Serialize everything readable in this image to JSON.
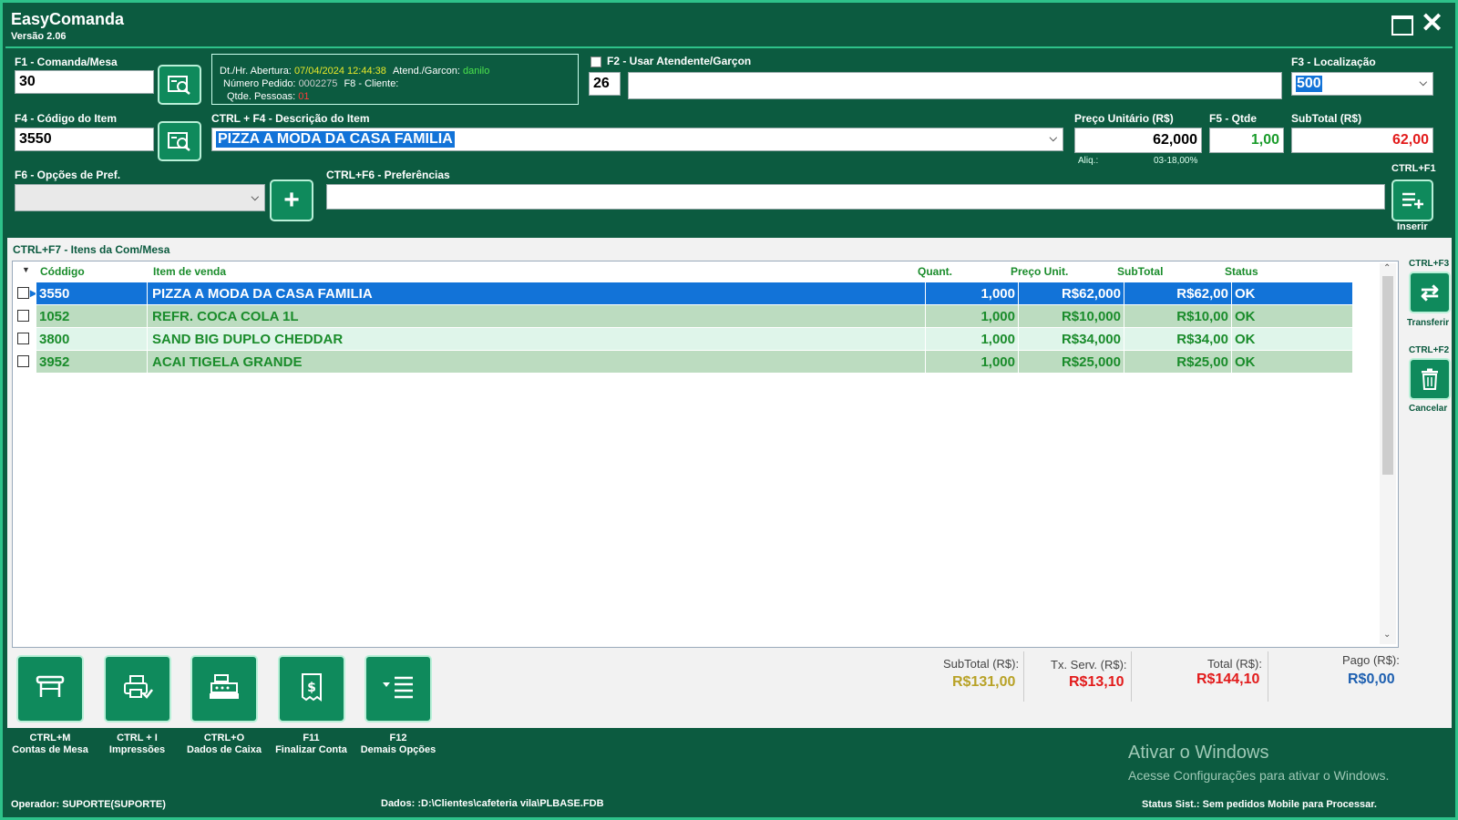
{
  "window": {
    "title": "EasyComanda",
    "version": "Versão 2.06"
  },
  "comanda": {
    "label": "F1 - Comanda/Mesa",
    "value": "30"
  },
  "info": {
    "abertura_label": "Dt./Hr. Abertura:",
    "abertura_value": "07/04/2024 12:44:38",
    "atend_label": "Atend./Garcon:",
    "atend_value": "danilo",
    "pedido_label": "Número Pedido:",
    "pedido_value": "0002275",
    "cliente_label": "F8 - Cliente:",
    "pessoas_label": "Qtde. Pessoas:",
    "pessoas_value": "01"
  },
  "atendente": {
    "label": "F2 - Usar Atendente/Garçon",
    "code": "26",
    "name": ""
  },
  "localizacao": {
    "label": "F3 - Localização",
    "value": "500"
  },
  "item": {
    "codigo_label": "F4 - Código do Item",
    "codigo_value": "3550",
    "descricao_label": "CTRL + F4 - Descrição do Item",
    "descricao_value": "PIZZA A MODA DA CASA FAMILIA",
    "preco_label": "Preço Unitário (R$)",
    "preco_value": "62,000",
    "aliq_label": "Aliq.:",
    "aliq_value": "03-18,00%",
    "qtde_label": "F5 - Qtde",
    "qtde_value": "1,00",
    "subtotal_label": "SubTotal (R$)",
    "subtotal_value": "62,00"
  },
  "pref": {
    "opcoes_label": "F6 - Opções de Pref.",
    "preferencias_label": "CTRL+F6 - Preferências",
    "inserir_shortcut": "CTRL+F1",
    "inserir_label": "Inserir"
  },
  "grid": {
    "title": "CTRL+F7 - Itens da Com/Mesa",
    "headers": {
      "codigo": "Códdigo",
      "item": "Item de venda",
      "quant": "Quant.",
      "preco": "Preço Unit.",
      "subtotal": "SubTotal",
      "status": "Status"
    },
    "rows": [
      {
        "codigo": "3550",
        "item": "PIZZA A MODA DA CASA FAMILIA",
        "quant": "1,000",
        "preco": "R$62,000",
        "subtotal": "R$62,00",
        "status": "OK"
      },
      {
        "codigo": "1052",
        "item": "REFR. COCA COLA 1L",
        "quant": "1,000",
        "preco": "R$10,000",
        "subtotal": "R$10,00",
        "status": "OK"
      },
      {
        "codigo": "3800",
        "item": "SAND BIG DUPLO CHEDDAR",
        "quant": "1,000",
        "preco": "R$34,000",
        "subtotal": "R$34,00",
        "status": "OK"
      },
      {
        "codigo": "3952",
        "item": "ACAI TIGELA GRANDE",
        "quant": "1,000",
        "preco": "R$25,000",
        "subtotal": "R$25,00",
        "status": "OK"
      }
    ]
  },
  "side": {
    "transferir_shortcut": "CTRL+F3",
    "transferir_label": "Transferir",
    "cancelar_shortcut": "CTRL+F2",
    "cancelar_label": "Cancelar"
  },
  "bottom_buttons": [
    {
      "shortcut": "CTRL+M",
      "label": "Contas de Mesa",
      "icon": "table-icon"
    },
    {
      "shortcut": "CTRL + I",
      "label": "Impressões",
      "icon": "printer-icon"
    },
    {
      "shortcut": "CTRL+O",
      "label": "Dados de Caixa",
      "icon": "cash-register-icon"
    },
    {
      "shortcut": "F11",
      "label": "Finalizar Conta",
      "icon": "bill-icon"
    },
    {
      "shortcut": "F12",
      "label": "Demais Opções",
      "icon": "menu-list-icon"
    }
  ],
  "totals": {
    "subtotal_label": "SubTotal (R$):",
    "subtotal_value": "R$131,00",
    "txserv_label": "Tx. Serv. (R$):",
    "txserv_value": "R$13,10",
    "total_label": "Total (R$):",
    "total_value": "R$144,10",
    "pago_label": "Pago (R$):",
    "pago_value": "R$0,00"
  },
  "watermark": {
    "title": "Ativar o Windows",
    "subtitle": "Acesse Configurações para ativar o Windows."
  },
  "statusbar": {
    "operador_label": "Operador:",
    "operador_value": "SUPORTE(SUPORTE)",
    "dados_label": "Dados:",
    "dados_value": ":D:\\Clientes\\cafeteria vila\\PLBASE.FDB",
    "status_label": "Status Sist.:",
    "status_value": "Sem pedidos Mobile para Processar."
  },
  "colors": {
    "background": "#0c5b40",
    "accent": "#0f8a5c",
    "selected_row": "#1273d8",
    "row_green": "#bcdcc0",
    "row_light": "#dff5ea",
    "text_green": "#1a8c2b",
    "total_red": "#e21b1b",
    "paid_blue": "#1d5fb0"
  }
}
